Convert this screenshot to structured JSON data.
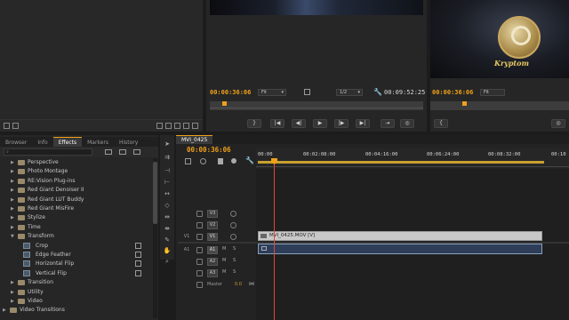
{
  "source_monitor": {},
  "program_monitor": {
    "timecode_left": "00:00:36:06",
    "fit": "Fit",
    "resolution": "1/2",
    "duration": "00:09:52:25"
  },
  "ref_monitor": {
    "timecode": "00:00:36:06"
  },
  "logo": {
    "text": "Kryptom"
  },
  "effects_panel": {
    "tabs": [
      "Browser",
      "Info",
      "Effects",
      "Markers",
      "History"
    ],
    "active_tab": "Effects",
    "tree": [
      {
        "label": "Perspective",
        "indent": 1,
        "type": "folder",
        "expanded": false
      },
      {
        "label": "Photo Montage",
        "indent": 1,
        "type": "folder",
        "expanded": false
      },
      {
        "label": "RE:Vision Plug-ins",
        "indent": 1,
        "type": "folder",
        "expanded": false
      },
      {
        "label": "Red Giant Denoiser II",
        "indent": 1,
        "type": "folder",
        "expanded": false
      },
      {
        "label": "Red Giant LUT Buddy",
        "indent": 1,
        "type": "folder",
        "expanded": false
      },
      {
        "label": "Red Giant MisFire",
        "indent": 1,
        "type": "folder",
        "expanded": false
      },
      {
        "label": "Stylize",
        "indent": 1,
        "type": "folder",
        "expanded": false
      },
      {
        "label": "Time",
        "indent": 1,
        "type": "folder",
        "expanded": false
      },
      {
        "label": "Transform",
        "indent": 1,
        "type": "folder",
        "expanded": true
      },
      {
        "label": "Crop",
        "indent": 2,
        "type": "effect"
      },
      {
        "label": "Edge Feather",
        "indent": 2,
        "type": "effect"
      },
      {
        "label": "Horizontal Flip",
        "indent": 2,
        "type": "effect"
      },
      {
        "label": "Vertical Flip",
        "indent": 2,
        "type": "effect"
      },
      {
        "label": "Transition",
        "indent": 1,
        "type": "folder",
        "expanded": false
      },
      {
        "label": "Utility",
        "indent": 1,
        "type": "folder",
        "expanded": false
      },
      {
        "label": "Video",
        "indent": 1,
        "type": "folder",
        "expanded": false
      },
      {
        "label": "Video Transitions",
        "indent": 0,
        "type": "folder",
        "expanded": false
      }
    ]
  },
  "timeline": {
    "sequence_tab": "MVI_0425",
    "timecode": "00:00:36:06",
    "ruler": [
      "00:00",
      "00:02:08:00",
      "00:04:16:00",
      "00:06:24:00",
      "00:08:32:00",
      "00:10"
    ],
    "tracks": [
      {
        "source": "",
        "name": "V3",
        "type": "video"
      },
      {
        "source": "",
        "name": "V2",
        "type": "video"
      },
      {
        "source": "V1",
        "name": "V1",
        "type": "video"
      },
      {
        "source": "A1",
        "name": "A1",
        "type": "audio"
      },
      {
        "source": "",
        "name": "A2",
        "type": "audio"
      },
      {
        "source": "",
        "name": "A3",
        "type": "audio"
      }
    ],
    "master_label": "Master",
    "master_value": "0.0",
    "clip_label": "MVI_0425.MOV [V]"
  }
}
